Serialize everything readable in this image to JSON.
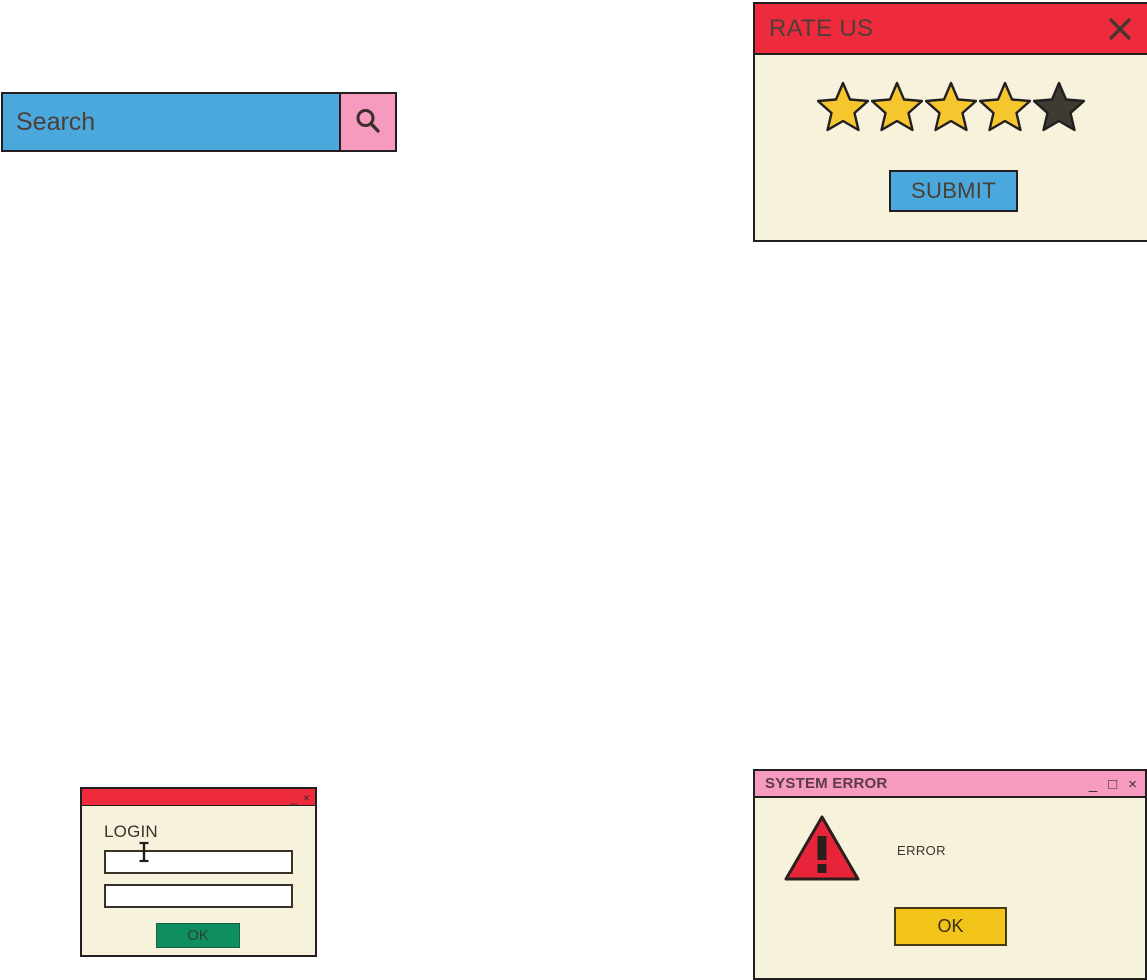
{
  "search": {
    "placeholder": "Search",
    "value": "",
    "button_icon": "search-icon",
    "field_color": "#4aa8dd",
    "button_color": "#f79ac0"
  },
  "rate_us": {
    "title": "RATE US",
    "close_icon": "close-icon",
    "titlebar_color": "#ee2b3c",
    "body_color": "#f7f2dc",
    "rating": {
      "filled": 4,
      "total": 5,
      "filled_color": "#f6c62e",
      "empty_color": "#3f3a32"
    },
    "submit_label": "SUBMIT",
    "submit_color": "#4aa8dd"
  },
  "login": {
    "title": "",
    "heading": "LOGIN",
    "titlebar_color": "#ee2b3c",
    "controls": [
      {
        "name": "minimize-button",
        "glyph": "_"
      },
      {
        "name": "close-button",
        "glyph": "×"
      }
    ],
    "fields": [
      {
        "name": "username-field",
        "value": "",
        "placeholder": ""
      },
      {
        "name": "password-field",
        "value": "",
        "placeholder": ""
      }
    ],
    "ok_label": "OK",
    "ok_color": "#0f8f5f",
    "cursor_icon": "text-cursor-icon"
  },
  "system_error": {
    "title": "SYSTEM ERROR",
    "titlebar_color": "#f79ac0",
    "message": "ERROR",
    "warning_icon": "warning-triangle-icon",
    "warning_color": "#e8243b",
    "controls": [
      {
        "name": "minimize-button",
        "glyph": "_"
      },
      {
        "name": "maximize-button",
        "glyph": "□"
      },
      {
        "name": "close-button",
        "glyph": "×"
      }
    ],
    "ok_label": "OK",
    "ok_color": "#f2c319"
  }
}
